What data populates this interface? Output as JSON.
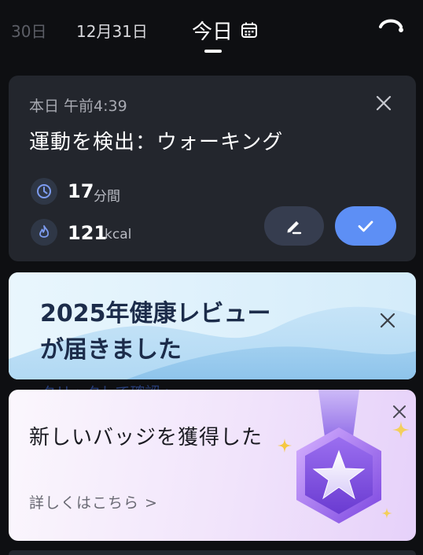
{
  "date_bar": {
    "prev2": "30日",
    "prev": "12月31日",
    "today": "今日"
  },
  "exercise_card": {
    "time": "本日 午前4:39",
    "title": "運動を検出：ウォーキング",
    "duration_value": "17",
    "duration_unit": "分間",
    "calories_value": "121",
    "calories_unit": "kcal"
  },
  "review_banner": {
    "title": "2025年健康レビューが届きました",
    "link_peek": "クリックして確認 >"
  },
  "badge_card": {
    "title": "新しいバッジを獲得した",
    "link": "詳しくはこちら >"
  },
  "colors": {
    "background": "#0e0f12",
    "card": "#23262d",
    "accent_blue": "#5d8ff5",
    "badge_purple": "#9a6cf0"
  },
  "icons": [
    "calendar-icon",
    "phone-hangup-icon",
    "close-icon",
    "clock-icon",
    "flame-icon",
    "pencil-icon",
    "check-icon",
    "sparkle-icon",
    "medal-star-icon"
  ]
}
